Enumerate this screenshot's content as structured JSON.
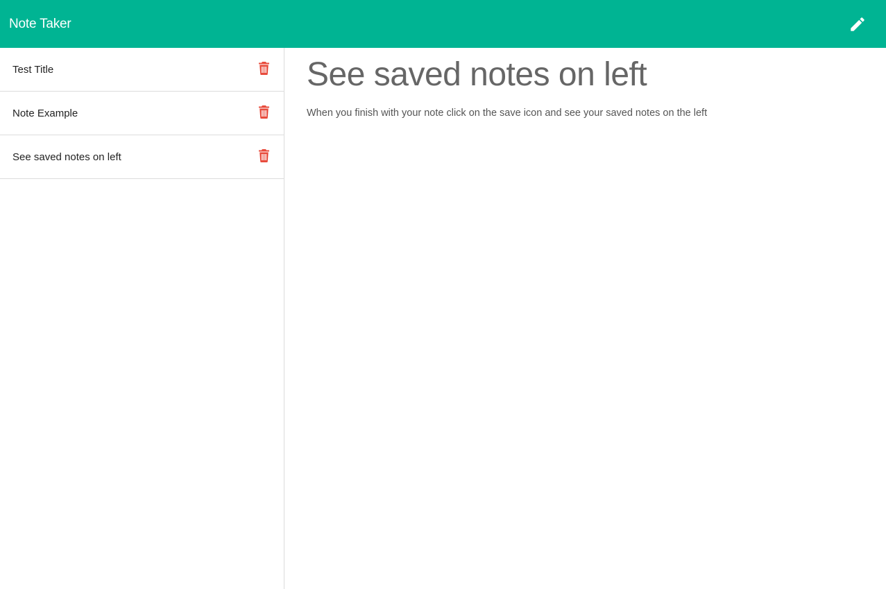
{
  "navbar": {
    "brand": "Note Taker",
    "new_note_icon": "pencil-icon",
    "background": "#00b493"
  },
  "sidebar": {
    "notes": [
      {
        "title": "Test Title",
        "delete_icon": "trash-icon"
      },
      {
        "title": "Note Example",
        "delete_icon": "trash-icon"
      },
      {
        "title": "See saved notes on left",
        "delete_icon": "trash-icon"
      }
    ],
    "delete_icon_color": "#e84c3d"
  },
  "main": {
    "title": "See saved notes on left",
    "text": "When you finish with your note click on the save icon and see your saved notes on the left"
  }
}
